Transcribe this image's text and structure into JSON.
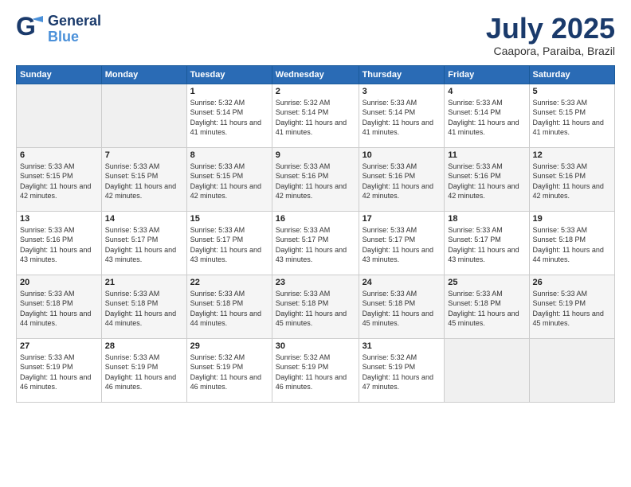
{
  "header": {
    "logo_general": "General",
    "logo_blue": "Blue",
    "title": "July 2025",
    "location": "Caapora, Paraiba, Brazil"
  },
  "days_of_week": [
    "Sunday",
    "Monday",
    "Tuesday",
    "Wednesday",
    "Thursday",
    "Friday",
    "Saturday"
  ],
  "weeks": [
    [
      {
        "day": "",
        "info": ""
      },
      {
        "day": "",
        "info": ""
      },
      {
        "day": "1",
        "info": "Sunrise: 5:32 AM\nSunset: 5:14 PM\nDaylight: 11 hours and 41 minutes."
      },
      {
        "day": "2",
        "info": "Sunrise: 5:32 AM\nSunset: 5:14 PM\nDaylight: 11 hours and 41 minutes."
      },
      {
        "day": "3",
        "info": "Sunrise: 5:33 AM\nSunset: 5:14 PM\nDaylight: 11 hours and 41 minutes."
      },
      {
        "day": "4",
        "info": "Sunrise: 5:33 AM\nSunset: 5:14 PM\nDaylight: 11 hours and 41 minutes."
      },
      {
        "day": "5",
        "info": "Sunrise: 5:33 AM\nSunset: 5:15 PM\nDaylight: 11 hours and 41 minutes."
      }
    ],
    [
      {
        "day": "6",
        "info": "Sunrise: 5:33 AM\nSunset: 5:15 PM\nDaylight: 11 hours and 42 minutes."
      },
      {
        "day": "7",
        "info": "Sunrise: 5:33 AM\nSunset: 5:15 PM\nDaylight: 11 hours and 42 minutes."
      },
      {
        "day": "8",
        "info": "Sunrise: 5:33 AM\nSunset: 5:15 PM\nDaylight: 11 hours and 42 minutes."
      },
      {
        "day": "9",
        "info": "Sunrise: 5:33 AM\nSunset: 5:16 PM\nDaylight: 11 hours and 42 minutes."
      },
      {
        "day": "10",
        "info": "Sunrise: 5:33 AM\nSunset: 5:16 PM\nDaylight: 11 hours and 42 minutes."
      },
      {
        "day": "11",
        "info": "Sunrise: 5:33 AM\nSunset: 5:16 PM\nDaylight: 11 hours and 42 minutes."
      },
      {
        "day": "12",
        "info": "Sunrise: 5:33 AM\nSunset: 5:16 PM\nDaylight: 11 hours and 42 minutes."
      }
    ],
    [
      {
        "day": "13",
        "info": "Sunrise: 5:33 AM\nSunset: 5:16 PM\nDaylight: 11 hours and 43 minutes."
      },
      {
        "day": "14",
        "info": "Sunrise: 5:33 AM\nSunset: 5:17 PM\nDaylight: 11 hours and 43 minutes."
      },
      {
        "day": "15",
        "info": "Sunrise: 5:33 AM\nSunset: 5:17 PM\nDaylight: 11 hours and 43 minutes."
      },
      {
        "day": "16",
        "info": "Sunrise: 5:33 AM\nSunset: 5:17 PM\nDaylight: 11 hours and 43 minutes."
      },
      {
        "day": "17",
        "info": "Sunrise: 5:33 AM\nSunset: 5:17 PM\nDaylight: 11 hours and 43 minutes."
      },
      {
        "day": "18",
        "info": "Sunrise: 5:33 AM\nSunset: 5:17 PM\nDaylight: 11 hours and 43 minutes."
      },
      {
        "day": "19",
        "info": "Sunrise: 5:33 AM\nSunset: 5:18 PM\nDaylight: 11 hours and 44 minutes."
      }
    ],
    [
      {
        "day": "20",
        "info": "Sunrise: 5:33 AM\nSunset: 5:18 PM\nDaylight: 11 hours and 44 minutes."
      },
      {
        "day": "21",
        "info": "Sunrise: 5:33 AM\nSunset: 5:18 PM\nDaylight: 11 hours and 44 minutes."
      },
      {
        "day": "22",
        "info": "Sunrise: 5:33 AM\nSunset: 5:18 PM\nDaylight: 11 hours and 44 minutes."
      },
      {
        "day": "23",
        "info": "Sunrise: 5:33 AM\nSunset: 5:18 PM\nDaylight: 11 hours and 45 minutes."
      },
      {
        "day": "24",
        "info": "Sunrise: 5:33 AM\nSunset: 5:18 PM\nDaylight: 11 hours and 45 minutes."
      },
      {
        "day": "25",
        "info": "Sunrise: 5:33 AM\nSunset: 5:18 PM\nDaylight: 11 hours and 45 minutes."
      },
      {
        "day": "26",
        "info": "Sunrise: 5:33 AM\nSunset: 5:19 PM\nDaylight: 11 hours and 45 minutes."
      }
    ],
    [
      {
        "day": "27",
        "info": "Sunrise: 5:33 AM\nSunset: 5:19 PM\nDaylight: 11 hours and 46 minutes."
      },
      {
        "day": "28",
        "info": "Sunrise: 5:33 AM\nSunset: 5:19 PM\nDaylight: 11 hours and 46 minutes."
      },
      {
        "day": "29",
        "info": "Sunrise: 5:32 AM\nSunset: 5:19 PM\nDaylight: 11 hours and 46 minutes."
      },
      {
        "day": "30",
        "info": "Sunrise: 5:32 AM\nSunset: 5:19 PM\nDaylight: 11 hours and 46 minutes."
      },
      {
        "day": "31",
        "info": "Sunrise: 5:32 AM\nSunset: 5:19 PM\nDaylight: 11 hours and 47 minutes."
      },
      {
        "day": "",
        "info": ""
      },
      {
        "day": "",
        "info": ""
      }
    ]
  ]
}
